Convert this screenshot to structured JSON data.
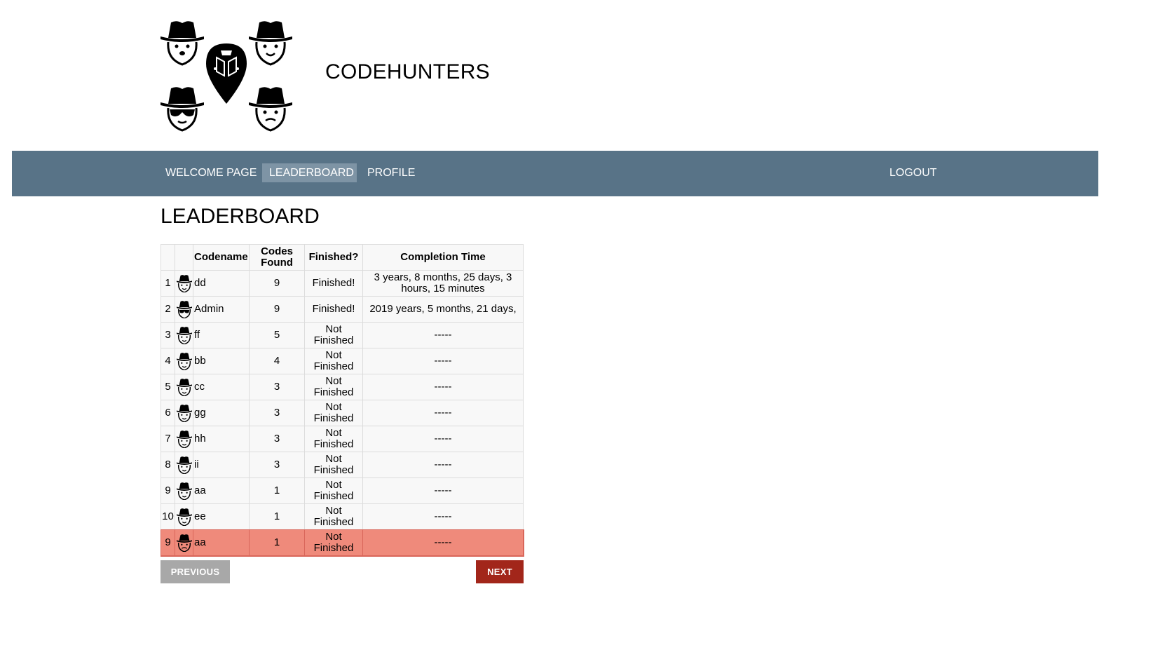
{
  "site": {
    "title": "CODEHUNTERS"
  },
  "nav": {
    "items": [
      {
        "label": "WELCOME PAGE",
        "active": false
      },
      {
        "label": "LEADERBOARD",
        "active": true
      },
      {
        "label": "PROFILE",
        "active": false
      }
    ],
    "logout": "LOGOUT"
  },
  "page": {
    "title": "LEADERBOARD"
  },
  "table": {
    "headers": [
      "",
      "",
      "Codename",
      "Codes Found",
      "Finished?",
      "Completion Time"
    ],
    "rows": [
      {
        "rank": "1",
        "avatar": "hat-face-smile-icon",
        "codename": "dd",
        "codes": "9",
        "finished": "Finished!",
        "time": "3 years, 8 months, 25 days, 3 hours, 15 minutes"
      },
      {
        "rank": "2",
        "avatar": "hat-face-sunglasses-icon",
        "codename": "Admin",
        "codes": "9",
        "finished": "Finished!",
        "time": "2019 years, 5 months, 21 days,"
      },
      {
        "rank": "3",
        "avatar": "hat-face-smile-icon",
        "codename": "ff",
        "codes": "5",
        "finished": "Not Finished",
        "time": "-----"
      },
      {
        "rank": "4",
        "avatar": "hat-face-smile-icon",
        "codename": "bb",
        "codes": "4",
        "finished": "Not Finished",
        "time": "-----"
      },
      {
        "rank": "5",
        "avatar": "hat-face-smile-icon",
        "codename": "cc",
        "codes": "3",
        "finished": "Not Finished",
        "time": "-----"
      },
      {
        "rank": "6",
        "avatar": "hat-face-smile-icon",
        "codename": "gg",
        "codes": "3",
        "finished": "Not Finished",
        "time": "-----"
      },
      {
        "rank": "7",
        "avatar": "hat-face-smile-icon",
        "codename": "hh",
        "codes": "3",
        "finished": "Not Finished",
        "time": "-----"
      },
      {
        "rank": "8",
        "avatar": "hat-face-smile-icon",
        "codename": "ii",
        "codes": "3",
        "finished": "Not Finished",
        "time": "-----"
      },
      {
        "rank": "9",
        "avatar": "hat-face-smile-icon",
        "codename": "aa",
        "codes": "1",
        "finished": "Not Finished",
        "time": "-----"
      },
      {
        "rank": "10",
        "avatar": "hat-face-smile-icon",
        "codename": "ee",
        "codes": "1",
        "finished": "Not Finished",
        "time": "-----"
      }
    ],
    "current_user": {
      "rank": "9",
      "avatar": "hat-face-mustache-icon",
      "codename": "aa",
      "codes": "1",
      "finished": "Not Finished",
      "time": "-----"
    }
  },
  "pagination": {
    "previous": "PREVIOUS",
    "next": "NEXT"
  },
  "colors": {
    "navbar": "#587387",
    "nav_active": "#7e94a5",
    "highlight_row": "#ef8a7b",
    "next_button": "#a2261a",
    "prev_button": "#a8a8a8"
  }
}
